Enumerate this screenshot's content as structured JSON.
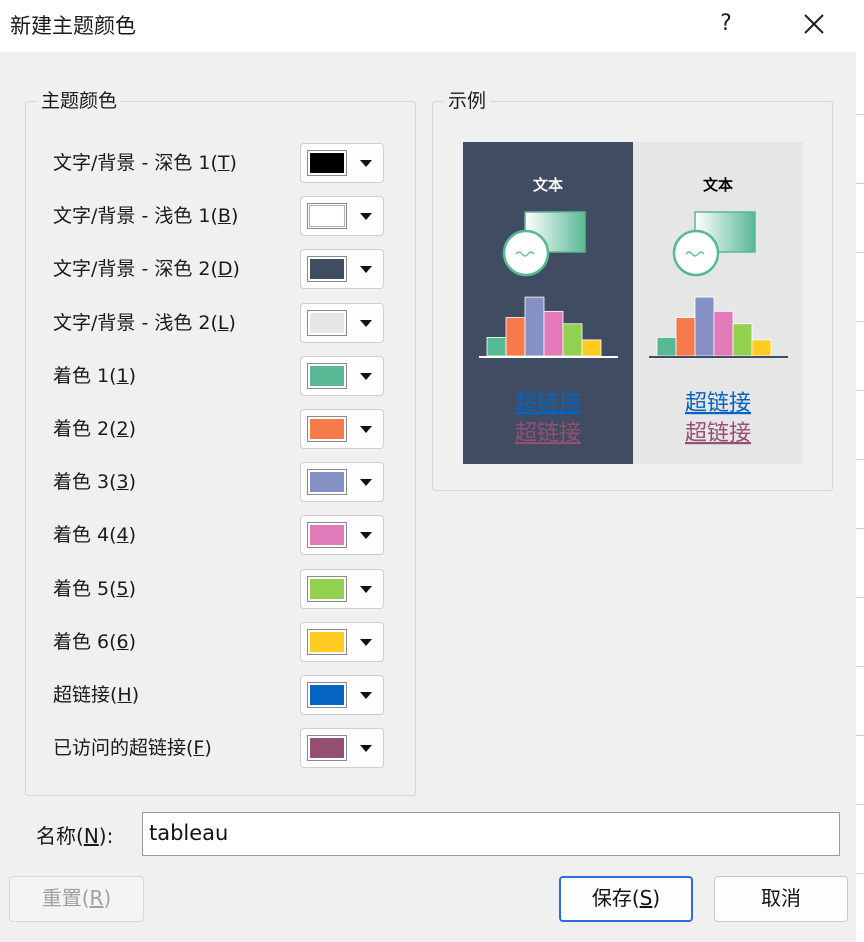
{
  "dialog": {
    "title": "新建主题颜色",
    "help": "?"
  },
  "theme_group": {
    "legend": "主题颜色",
    "rows": [
      {
        "label": "文字/背景 - 深色 1(",
        "key": "T",
        "end": ")",
        "color": "#000000"
      },
      {
        "label": "文字/背景 - 浅色 1(",
        "key": "B",
        "end": ")",
        "color": "#ffffff"
      },
      {
        "label": "文字/背景 - 深色 2(",
        "key": "D",
        "end": ")",
        "color": "#3f4c61"
      },
      {
        "label": "文字/背景 - 浅色 2(",
        "key": "L",
        "end": ")",
        "color": "#e6e6e6"
      },
      {
        "label": "着色 1(",
        "key": "1",
        "end": ")",
        "color": "#59b894"
      },
      {
        "label": "着色 2(",
        "key": "2",
        "end": ")",
        "color": "#f77a4c"
      },
      {
        "label": "着色 3(",
        "key": "3",
        "end": ")",
        "color": "#8590c4"
      },
      {
        "label": "着色 4(",
        "key": "4",
        "end": ")",
        "color": "#e07ab8"
      },
      {
        "label": "着色 5(",
        "key": "5",
        "end": ")",
        "color": "#92d050"
      },
      {
        "label": "着色 6(",
        "key": "6",
        "end": ")",
        "color": "#ffcc22"
      },
      {
        "label": "超链接(",
        "key": "H",
        "end": ")",
        "color": "#0563c1"
      },
      {
        "label": "已访问的超链接(",
        "key": "F",
        "end": ")",
        "color": "#954f72"
      }
    ]
  },
  "sample_group": {
    "legend": "示例",
    "text": "文本",
    "hyperlink": "超链接",
    "followed_hyperlink": "超链接",
    "bar_levels": [
      0.3,
      0.62,
      0.95,
      0.72,
      0.52,
      0.26
    ]
  },
  "name_field": {
    "label": "名称(",
    "key": "N",
    "end": "):",
    "value": "tableau"
  },
  "buttons": {
    "reset": {
      "label": "重置(",
      "key": "R",
      "end": ")"
    },
    "save": {
      "label": "保存(",
      "key": "S",
      "end": ")"
    },
    "cancel": {
      "label": "取消"
    }
  }
}
